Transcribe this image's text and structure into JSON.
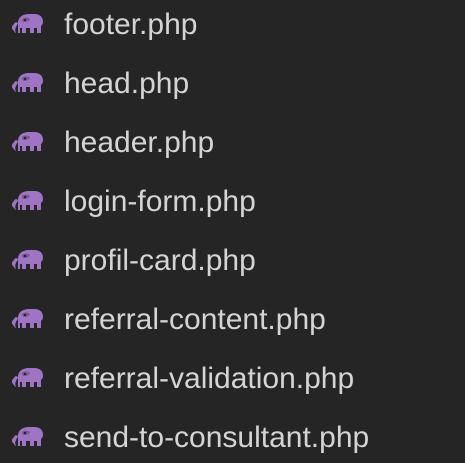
{
  "explorer": {
    "file_icon": "php-elephant-icon",
    "icon_color": "#a074c4",
    "files": [
      {
        "name": "footer.php"
      },
      {
        "name": "head.php"
      },
      {
        "name": "header.php"
      },
      {
        "name": "login-form.php"
      },
      {
        "name": "profil-card.php"
      },
      {
        "name": "referral-content.php"
      },
      {
        "name": "referral-validation.php"
      },
      {
        "name": "send-to-consultant.php"
      }
    ]
  }
}
